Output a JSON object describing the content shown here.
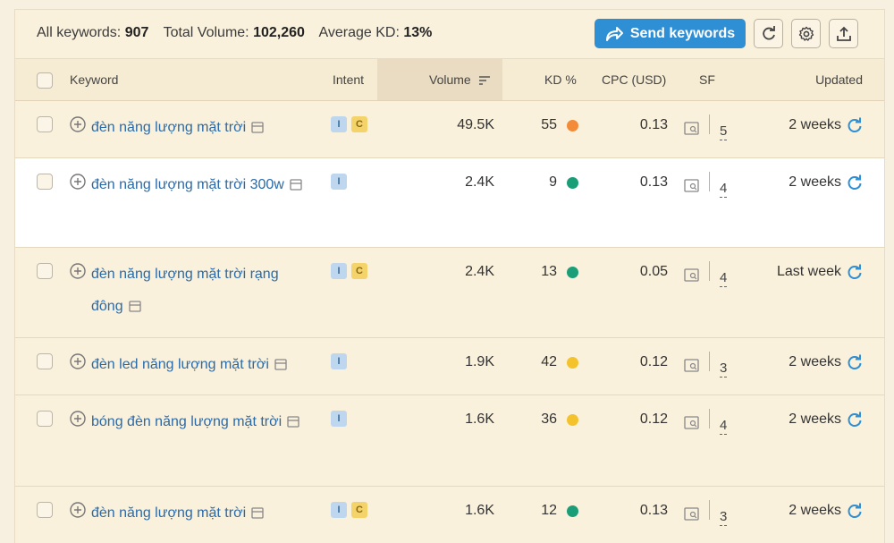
{
  "summary": {
    "all_keywords_label": "All keywords:",
    "all_keywords_value": "907",
    "total_volume_label": "Total Volume:",
    "total_volume_value": "102,260",
    "avg_kd_label": "Average KD:",
    "avg_kd_value": "13%"
  },
  "toolbar": {
    "send_label": "Send keywords",
    "send_icon": "share-arrow-icon",
    "refresh_icon": "refresh-icon",
    "settings_icon": "gear-icon",
    "export_icon": "export-icon"
  },
  "columns": {
    "keyword": "Keyword",
    "intent": "Intent",
    "volume": "Volume",
    "kd": "KD %",
    "cpc": "CPC (USD)",
    "sf": "SF",
    "updated": "Updated"
  },
  "colors": {
    "accent": "#2f8fd5",
    "kd_orange": "#f28c38",
    "kd_green": "#1a9e78",
    "kd_yellow": "#f4c22b",
    "link": "#2b6aa8"
  },
  "rows": [
    {
      "keyword": "đèn năng lượng mặt trời",
      "intent": [
        "I",
        "C"
      ],
      "volume": "49.5K",
      "kd": "55",
      "kd_color": "#f28c38",
      "cpc": "0.13",
      "sf": "5",
      "updated": "2 weeks"
    },
    {
      "keyword": "đèn năng lượng mặt trời 300w",
      "intent": [
        "I"
      ],
      "volume": "2.4K",
      "kd": "9",
      "kd_color": "#1a9e78",
      "cpc": "0.13",
      "sf": "4",
      "updated": "2 weeks"
    },
    {
      "keyword": "đèn năng lượng mặt trời rạng đông",
      "intent": [
        "I",
        "C"
      ],
      "volume": "2.4K",
      "kd": "13",
      "kd_color": "#1a9e78",
      "cpc": "0.05",
      "sf": "4",
      "updated": "Last week"
    },
    {
      "keyword": "đèn led năng lượng mặt trời",
      "intent": [
        "I"
      ],
      "volume": "1.9K",
      "kd": "42",
      "kd_color": "#f4c22b",
      "cpc": "0.12",
      "sf": "3",
      "updated": "2 weeks"
    },
    {
      "keyword": "bóng đèn năng lượng mặt trời",
      "intent": [
        "I"
      ],
      "volume": "1.6K",
      "kd": "36",
      "kd_color": "#f4c22b",
      "cpc": "0.12",
      "sf": "4",
      "updated": "2 weeks"
    },
    {
      "keyword": "đèn năng lượng mặt trời",
      "intent": [
        "I",
        "C"
      ],
      "volume": "1.6K",
      "kd": "12",
      "kd_color": "#1a9e78",
      "cpc": "0.13",
      "sf": "3",
      "updated": "2 weeks"
    }
  ]
}
